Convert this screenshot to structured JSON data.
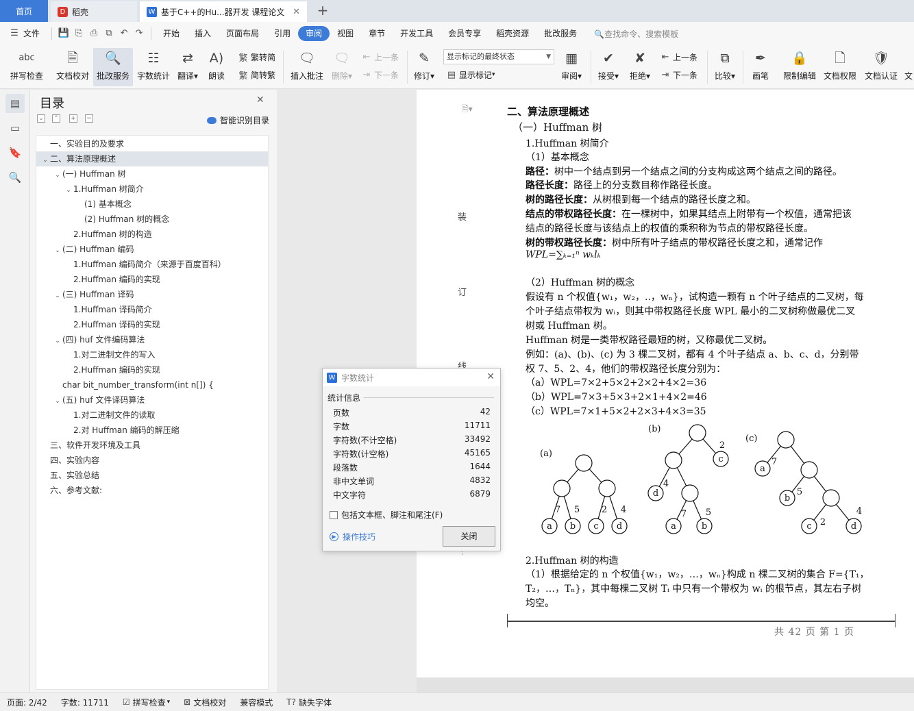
{
  "tabs": {
    "home": "首页",
    "wps": "稻壳",
    "doc": "基于C++的Hu...器开发 课程论文"
  },
  "menu": {
    "file": "文件",
    "items": [
      "开始",
      "插入",
      "页面布局",
      "引用",
      "审阅",
      "视图",
      "章节",
      "开发工具",
      "会员专享",
      "稻壳资源",
      "批改服务"
    ],
    "active_index": 4,
    "search": "查找命令、搜索模板"
  },
  "ribbon": {
    "spell": "拼写检查",
    "proof": "文档校对",
    "correct": "批改服务",
    "count": "字数统计",
    "translate": "翻译",
    "read": "朗读",
    "to_trad": "繁转简",
    "to_simp": "简转繁",
    "insert_comment": "插入批注",
    "delete": "删除",
    "prev": "上一条",
    "next": "下一条",
    "track": "修订",
    "markup_select": "显示标记的最终状态",
    "show_markup": "显示标记",
    "review": "审阅",
    "accept": "接受",
    "reject": "拒绝",
    "prev2": "上一条",
    "next2": "下一条",
    "compare": "比较",
    "pen": "画笔",
    "restrict": "限制编辑",
    "perm": "文档权限",
    "cert": "文档认证",
    "more": "文"
  },
  "toc": {
    "title": "目录",
    "smart": "智能识别目录",
    "items": [
      {
        "text": "一、实验目的及要求",
        "level": 0,
        "arrow": "",
        "sel": false
      },
      {
        "text": "二、算法原理概述",
        "level": 0,
        "arrow": "⌄",
        "sel": true
      },
      {
        "text": "(一) Huffman 树",
        "level": 1,
        "arrow": "⌄",
        "sel": false
      },
      {
        "text": "1.Huffman 树简介",
        "level": 2,
        "arrow": "⌄",
        "sel": false
      },
      {
        "text": "(1) 基本概念",
        "level": 3,
        "arrow": "",
        "sel": false
      },
      {
        "text": "(2) Huffman 树的概念",
        "level": 3,
        "arrow": "",
        "sel": false
      },
      {
        "text": "2.Huffman 树的构造",
        "level": 2,
        "arrow": "",
        "sel": false
      },
      {
        "text": "(二) Huffman 编码",
        "level": 1,
        "arrow": "⌄",
        "sel": false
      },
      {
        "text": "1.Huffman 编码简介（来源于百度百科）",
        "level": 2,
        "arrow": "",
        "sel": false
      },
      {
        "text": "2.Huffman 编码的实现",
        "level": 2,
        "arrow": "",
        "sel": false
      },
      {
        "text": "(三) Huffman 译码",
        "level": 1,
        "arrow": "⌄",
        "sel": false
      },
      {
        "text": "1.Huffman 译码简介",
        "level": 2,
        "arrow": "",
        "sel": false
      },
      {
        "text": "2.Huffman 译码的实现",
        "level": 2,
        "arrow": "",
        "sel": false
      },
      {
        "text": "(四) huf 文件编码算法",
        "level": 1,
        "arrow": "⌄",
        "sel": false
      },
      {
        "text": "1.对二进制文件的写入",
        "level": 2,
        "arrow": "",
        "sel": false
      },
      {
        "text": "2.Huffman 编码的实现",
        "level": 2,
        "arrow": "",
        "sel": false
      },
      {
        "text": "char bit_number_transform(int n[]) {",
        "level": 1,
        "arrow": "",
        "sel": false
      },
      {
        "text": "(五) huf 文件译码算法",
        "level": 1,
        "arrow": "⌄",
        "sel": false
      },
      {
        "text": "1.对二进制文件的读取",
        "level": 2,
        "arrow": "",
        "sel": false
      },
      {
        "text": "2.对 Huffman 编码的解压缩",
        "level": 2,
        "arrow": "",
        "sel": false
      },
      {
        "text": "三、软件开发环境及工具",
        "level": 0,
        "arrow": "",
        "sel": false
      },
      {
        "text": "四、实验内容",
        "level": 0,
        "arrow": "",
        "sel": false
      },
      {
        "text": "五、实验总结",
        "level": 0,
        "arrow": "",
        "sel": false
      },
      {
        "text": "六、参考文献:",
        "level": 0,
        "arrow": "",
        "sel": false
      }
    ]
  },
  "binding_marks": [
    "装",
    "订",
    "线"
  ],
  "doc": {
    "h2": "二、算法原理概述",
    "h3": "（一）Huffman 树",
    "s1": "1.Huffman 树简介",
    "s1a": "（1）基本概念",
    "p1b": "路径：",
    "p1": "树中一个结点到另一个结点之间的分支构成这两个结点之间的路径。",
    "p2b": "路径长度：",
    "p2": "路径上的分支数目称作路径长度。",
    "p3b": "树的路径长度：",
    "p3": "从树根到每一个结点的路径长度之和。",
    "p4b": "结点的带权路径长度：",
    "p4": "在一棵树中，如果其结点上附带有一个权值，通常把该",
    "p4c": "结点的路径长度与该结点上的权值的乘积称为节点的带权路径长度。",
    "p5b": "树的带权路径长度：",
    "p5": "树中所有叶子结点的带权路径长度之和，通常记作",
    "formula": "WPL=∑ₖ₌₁ⁿ wₖlₖ",
    "s1b": "（2）Huffman 树的概念",
    "q1": "假设有 n 个权值{w₁，w₂，..，wₙ}，试构造一颗有 n 个叶子结点的二叉树，每",
    "q2": "个叶子结点带权为 wᵢ，则其中带权路径长度 WPL 最小的二叉树称做最优二叉",
    "q3": "树或 Huffman 树。",
    "q4": "Huffman 树是一类带权路径最短的树，又称最优二叉树。",
    "q5": "例如：(a)、(b)、(c) 为 3 棵二叉树，都有 4 个叶子结点 a、b、c、d，分别带",
    "q6": "权 7、5、2、4，他们的带权路径长度分别为：",
    "w1": "（a）WPL=7×2+5×2+2×2+4×2=36",
    "w2": "（b）WPL=7×3+5×3+2×1+4×2=46",
    "w3": "（c）WPL=7×1+5×2+2×3+4×3=35",
    "s2": "2.Huffman 树的构造",
    "r1": "（1）根据给定的 n 个权值{w₁，w₂，…，wₙ}构成 n 棵二叉树的集合 F={T₁，",
    "r2": "T₂，…，Tₙ}，其中每棵二叉树 Tᵢ 中只有一个带权为 wᵢ 的根节点，其左右子树",
    "r3": "均空。",
    "footer": "共  42  页    第  1  页"
  },
  "trees": {
    "a_label": "(a)",
    "b_label": "(b)",
    "c_label": "(c)",
    "leaves": [
      "a",
      "b",
      "c",
      "d"
    ],
    "weights": [
      "7",
      "5",
      "2",
      "4"
    ]
  },
  "dialog": {
    "title": "字数统计",
    "section": "统计信息",
    "rows": [
      {
        "k": "页数",
        "v": "42"
      },
      {
        "k": "字数",
        "v": "11711"
      },
      {
        "k": "字符数(不计空格)",
        "v": "33492"
      },
      {
        "k": "字符数(计空格)",
        "v": "45165"
      },
      {
        "k": "段落数",
        "v": "1644"
      },
      {
        "k": "非中文单词",
        "v": "4832"
      },
      {
        "k": "中文字符",
        "v": "6879"
      }
    ],
    "checkbox": "包括文本框、脚注和尾注(F)",
    "tips": "操作技巧",
    "close": "关闭"
  },
  "status": {
    "page": "页面: 2/42",
    "words": "字数: 11711",
    "spell": "拼写检查",
    "proof": "文档校对",
    "compat": "兼容模式",
    "font": "缺失字体"
  },
  "colors": {
    "accent": "#3c7bd7",
    "wps_red": "#d9352b"
  }
}
